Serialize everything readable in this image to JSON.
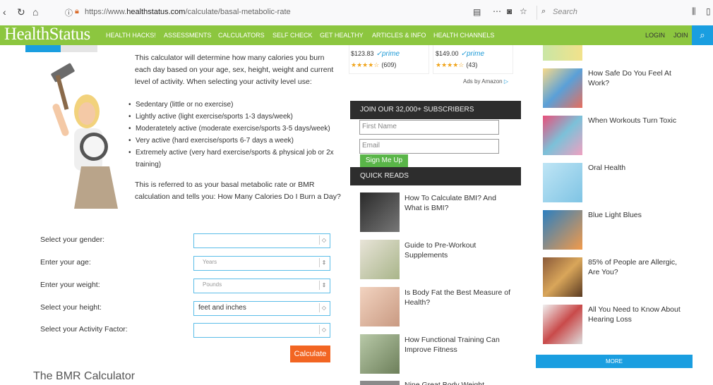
{
  "browser": {
    "url_prefix": "https://www.",
    "url_domain": "healthstatus.com",
    "url_path": "/calculate/basal-metabolic-rate",
    "search_placeholder": "Search"
  },
  "nav": {
    "logo": "HealthStatus",
    "items": [
      "HEALTH HACKS!",
      "ASSESSMENTS",
      "CALCULATORS",
      "SELF CHECK",
      "GET HEALTHY",
      "ARTICLES & INFO",
      "HEALTH CHANNELS"
    ],
    "login": "LOGIN",
    "join": "JOIN"
  },
  "intro": {
    "p1": "This calculator will determine how many calories you burn each day based on your age, sex, height, weight and current level of activity. When selecting your activity level use:",
    "levels": [
      "Sedentary (little or no exercise)",
      "Lightly active (light exercise/sports 1-3 days/week)",
      "Moderatetely active (moderate exercise/sports 3-5 days/week)",
      "Very active (hard exercise/sports 6-7 days a week)",
      "Extremely active (very hard exercise/sports & physical job or 2x training)"
    ],
    "p2": "This is referred to as your basal metabolic rate or BMR calculation and tells you: How Many Calories Do I Burn a Day?"
  },
  "form": {
    "gender_label": "Select your gender:",
    "age_label": "Enter your age:",
    "age_placeholder": "Years",
    "weight_label": "Enter your weight:",
    "weight_placeholder": "Pounds",
    "height_label": "Select your height:",
    "height_value": "feet and inches",
    "activity_label": "Select your Activity Factor:",
    "calculate": "Calculate"
  },
  "bmr_title": "The BMR Calculator",
  "ads": {
    "product1": {
      "price": "$123.83",
      "prime": "prime",
      "reviews": "(609)",
      "stars": "★★★★☆"
    },
    "product2": {
      "price": "$149.00",
      "prime": "prime",
      "reviews": "(43)",
      "stars": "★★★★☆"
    },
    "by": "Ads by Amazon"
  },
  "subscribe": {
    "header": "JOIN OUR 32,000+ SUBSCRIBERS",
    "first_name": "First Name",
    "email": "Email",
    "button": "Sign Me Up"
  },
  "quick_reads": {
    "header": "QUICK READS",
    "items": [
      "How To Calculate BMI? And What is BMI?",
      "Guide to Pre-Workout Supplements",
      "Is Body Fat the Best Measure of Health?",
      "How Functional Training Can Improve Fitness",
      "Nine Great Body Weight"
    ]
  },
  "sidebar": {
    "items": [
      "How Safe Do You Feel At Work?",
      "When Workouts Turn Toxic",
      "Oral Health",
      "Blue Light Blues",
      "85% of People are Allergic, Are You?",
      "All You Need to Know About Hearing Loss"
    ],
    "more": "MORE"
  },
  "colors": {
    "nav_green": "#8cc63f",
    "accent_blue": "#1a9ee0",
    "calc_orange": "#f26522",
    "signup_green": "#59b548"
  }
}
